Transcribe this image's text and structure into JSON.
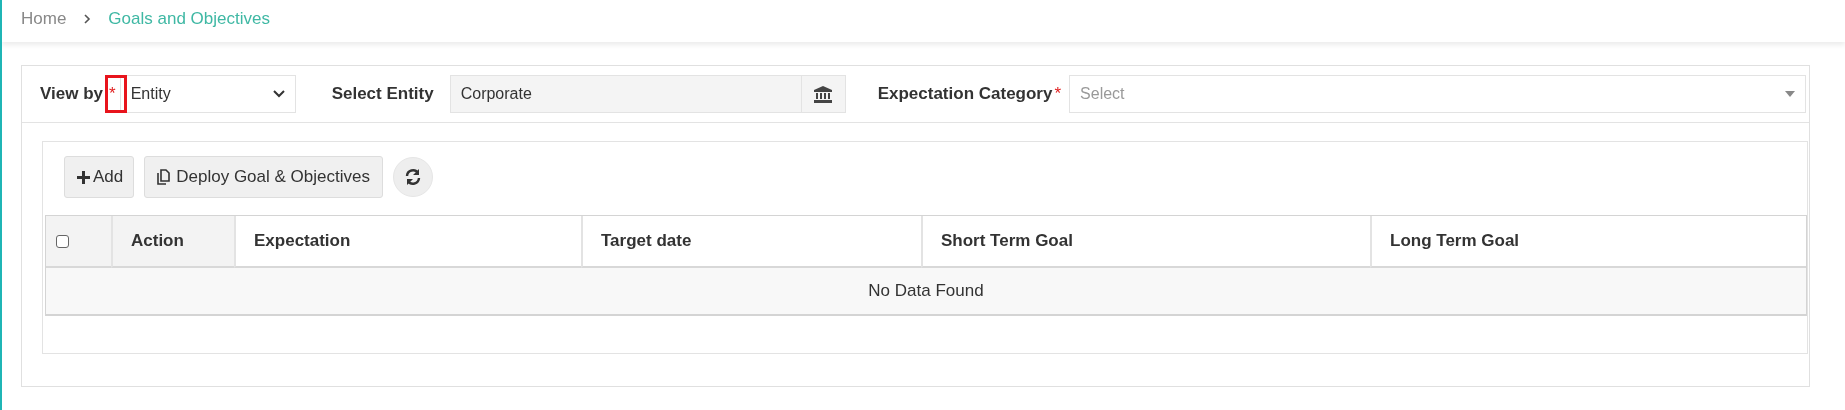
{
  "breadcrumb": [
    {
      "label": "Home",
      "current": false
    },
    {
      "label": "Goals and Objectives",
      "current": true
    }
  ],
  "filters": [
    {
      "kind": "select",
      "label": "View by",
      "required_mark": "*",
      "highlighted": true,
      "value": "Entity"
    },
    {
      "kind": "lookup",
      "label": "Select Entity",
      "highlighted": false,
      "value": "Corporate"
    },
    {
      "kind": "combo",
      "label": "Expectation Category",
      "required_mark": "*",
      "highlighted": false,
      "placeholder": "Select"
    }
  ],
  "toolbar": [
    {
      "kind": "add",
      "label": "Add"
    },
    {
      "kind": "copy",
      "label": "Deploy Goal & Objectives"
    },
    {
      "kind": "refresh"
    }
  ],
  "table": {
    "select_all": {
      "checked": false
    },
    "columns": [
      "Action",
      "Expectation",
      "Target date",
      "Short Term Goal",
      "Long Term Goal"
    ],
    "empty_message": "No Data Found"
  }
}
